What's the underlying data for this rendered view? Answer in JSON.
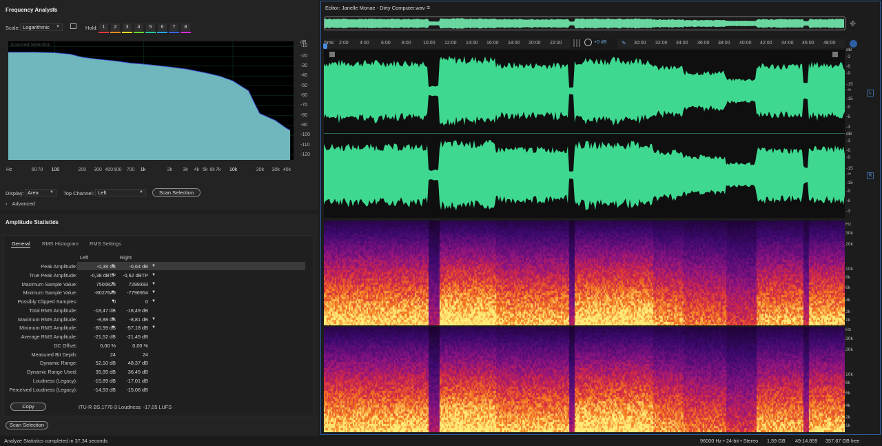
{
  "freq": {
    "title": "Frequency Analysis",
    "scale_label": "Scale:",
    "scale_value": "Logarithmic",
    "hold_label": "Hold:",
    "hold": [
      {
        "label": "1",
        "color": "#e33b3b"
      },
      {
        "label": "2",
        "color": "#f08a1e"
      },
      {
        "label": "3",
        "color": "#e8de1e"
      },
      {
        "label": "4",
        "color": "#6fd62c"
      },
      {
        "label": "5",
        "color": "#23c9a0"
      },
      {
        "label": "6",
        "color": "#23a6e8"
      },
      {
        "label": "7",
        "color": "#3a63e8"
      },
      {
        "label": "8",
        "color": "#d62cd6"
      }
    ],
    "plot_caption": "Scanned Selection",
    "db_unit": "dB",
    "db_ticks": [
      "-10",
      "-20",
      "-30",
      "-40",
      "-50",
      "-60",
      "-70",
      "-80",
      "-90",
      "-100",
      "-110",
      "-120"
    ],
    "hz_unit": "Hz",
    "hz_ticks": [
      "60",
      "70",
      "100",
      "200",
      "300",
      "400",
      "500",
      "700",
      "1k",
      "2k",
      "3k",
      "4k",
      "5k",
      "6k",
      "7k",
      "10k",
      "20k",
      "30k",
      "40k"
    ],
    "display_label": "Display:",
    "display_value": "Area",
    "top_channel_label": "Top Channel:",
    "top_channel_value": "Left",
    "scan_button": "Scan Selection",
    "advanced": "Advanced"
  },
  "chart_data": {
    "type": "area",
    "title": "",
    "xlabel": "Hz",
    "ylabel": "dB",
    "x_scale": "log",
    "x": [
      30,
      60,
      100,
      150,
      200,
      300,
      500,
      700,
      1000,
      2000,
      3000,
      5000,
      7000,
      10000,
      15000,
      18000,
      20000,
      30000,
      40000,
      44000
    ],
    "y": [
      -16,
      -16,
      -16.5,
      -18,
      -21,
      -23,
      -25,
      -27,
      -28,
      -31,
      -33,
      -37,
      -40,
      -45,
      -55,
      -70,
      -78,
      -85,
      -93,
      -95
    ],
    "ylim": [
      -125,
      -5
    ],
    "xlim": [
      30,
      48000
    ],
    "fill": "#6fb7bd",
    "grid": true
  },
  "amp": {
    "title": "Amplitude Statistics",
    "tabs": [
      "General",
      "RMS Histogram",
      "RMS Settings"
    ],
    "col_left": "Left",
    "col_right": "Right",
    "rows": [
      {
        "label": "Peak Amplitude:",
        "left": "-0,38 dB",
        "right": "-0,64 dB",
        "m": true
      },
      {
        "label": "True Peak Amplitude:",
        "left": "-0,38 dBTP",
        "right": "-0,62 dBTP",
        "m": true
      },
      {
        "label": "Maximum Sample Value:",
        "left": "7500823",
        "right": "7299393",
        "m": true
      },
      {
        "label": "Minimum Sample Value:",
        "left": "-8027649",
        "right": "-7796954",
        "m": true
      },
      {
        "label": "Possibly Clipped Samples:",
        "left": "0",
        "right": "0",
        "m": true
      },
      {
        "label": "Total RMS Amplitude:",
        "left": "-18,47 dB",
        "right": "-18,49 dB",
        "m": false
      },
      {
        "label": "Maximum RMS Amplitude:",
        "left": "-8,88 dB",
        "right": "-8,81 dB",
        "m": true
      },
      {
        "label": "Minimum RMS Amplitude:",
        "left": "-60,99 dB",
        "right": "-57,18 dB",
        "m": true
      },
      {
        "label": "Average RMS Amplitude:",
        "left": "-21,52 dB",
        "right": "-21,45 dB",
        "m": false
      },
      {
        "label": "DC Offset:",
        "left": "0,00 %",
        "right": "0,00 %",
        "m": false
      },
      {
        "label": "Measured Bit Depth:",
        "left": "24",
        "right": "24",
        "m": false
      },
      {
        "label": "Dynamic Range:",
        "left": "52,10 dB",
        "right": "48,37 dB",
        "m": false
      },
      {
        "label": "Dynamic Range Used:",
        "left": "35,95 dB",
        "right": "36,45 dB",
        "m": false
      },
      {
        "label": "Loudness (Legacy):",
        "left": "-15,89 dB",
        "right": "-17,01 dB",
        "m": false
      },
      {
        "label": "Perceived Loudness (Legacy):",
        "left": "-14,93 dB",
        "right": "-15,06 dB",
        "m": false
      }
    ],
    "copy_button": "Copy",
    "lufs": "ITU-R BS.1770-3 Loudness: -17,05 LUFS",
    "scan_button": "Scan Selection"
  },
  "editor": {
    "title": "Editor: Janelle Monae - Dirty Computer.wav",
    "ruler_unit": "hms",
    "ruler_ticks": [
      "2:00",
      "4:00",
      "6:00",
      "8:00",
      "10:00",
      "12:00",
      "14:00",
      "16:00",
      "18:00",
      "20:00",
      "22:00",
      "30:00",
      "32:00",
      "34:00",
      "36:00",
      "38:00",
      "40:00",
      "42:00",
      "44:00",
      "46:00",
      "48:00"
    ],
    "gain": "+0 dB",
    "db_unit": "dB",
    "db_scale": [
      "-3",
      "-6",
      "-9",
      "-15",
      "-∞",
      "-15",
      "-9",
      "-6",
      "-3"
    ],
    "chan_left": "L",
    "chan_right": "R",
    "spec_unit": "Hz",
    "spec_scale": [
      "30k",
      "20k",
      "10k",
      "8k",
      "6k",
      "4k",
      "2k",
      "1k"
    ],
    "wave_color": "#3fd890"
  },
  "status": {
    "left": "Analyze Statistics completed in 37,34 seconds",
    "format": "96000 Hz • 24-bit • Stereo",
    "size": "1,59 GB",
    "duration": "49:14.859",
    "free": "357,67 GB free"
  }
}
